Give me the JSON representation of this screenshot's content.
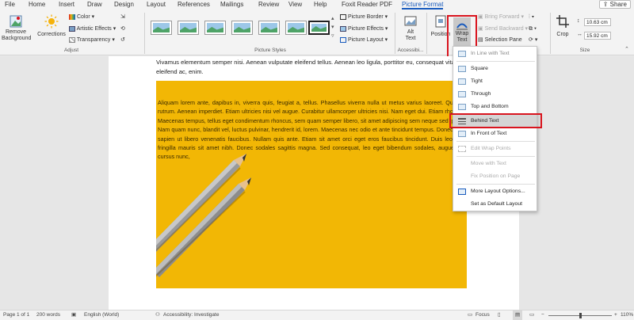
{
  "menu": {
    "tabs": [
      "File",
      "Home",
      "Insert",
      "Draw",
      "Design",
      "Layout",
      "References",
      "Mailings",
      "Review",
      "View",
      "Help",
      "Foxit Reader PDF",
      "Picture Format"
    ],
    "share_label": "Share"
  },
  "ribbon": {
    "adjust": {
      "remove_bg_label": "Remove Background",
      "corrections_label": "Corrections",
      "color_label": "Color",
      "artistic_label": "Artistic Effects",
      "transparency_label": "Transparency",
      "group_label": "Adjust"
    },
    "picture_styles": {
      "border_label": "Picture Border",
      "effects_label": "Picture Effects",
      "layout_label": "Picture Layout",
      "group_label": "Picture Styles"
    },
    "accessibility": {
      "alt_text_label": "Alt Text",
      "group_label": "Accessibi..."
    },
    "arrange": {
      "position_label": "Position",
      "wrap_text_label": "Wrap Text",
      "bring_forward_label": "Bring Forward",
      "send_backward_label": "Send Backward",
      "selection_pane_label": "Selection Pane"
    },
    "size": {
      "crop_label": "Crop",
      "height_value": "10.63 cm",
      "width_value": "15.92 cm",
      "group_label": "Size"
    }
  },
  "document": {
    "intro_text": "Vivamus elementum semper nisi. Aenean vulputate eleifend tellus. Aenean leo ligula, porttitor eu, consequat vitae, eleifend ac, enim.",
    "image_text": "Aliquam lorem ante, dapibus in, viverra quis, feugiat a, tellus. Phasellus viverra nulla ut metus varius laoreet. Quisque rutrum. Aenean imperdiet. Etiam ultricies nisi vel augue. Curabitur ullamcorper ultricies nisi. Nam eget dui. Etiam rhoncus. Maecenas tempus, tellus eget condimentum rhoncus, sem quam semper libero, sit amet adipiscing sem neque sed ipsum. Nam quam nunc, blandit vel, luctus pulvinar, hendrerit id, lorem. Maecenas nec odio et ante tincidunt tempus. Donec vitae sapien ut libero venenatis faucibus. Nullam quis ante. Etiam sit amet orci eget eros faucibus tincidunt. Duis leo. Sed fringilla mauris sit amet nibh. Donec sodales sagittis magna. Sed consequat, leo eget bibendum sodales, augue velit cursus nunc,"
  },
  "wrap_menu": {
    "items": [
      {
        "label": "In Line with Text",
        "enabled": true
      },
      {
        "label": "Square",
        "enabled": true
      },
      {
        "label": "Tight",
        "enabled": true
      },
      {
        "label": "Through",
        "enabled": true
      },
      {
        "label": "Top and Bottom",
        "enabled": true
      },
      {
        "label": "Behind Text",
        "enabled": true,
        "selected": true
      },
      {
        "label": "In Front of Text",
        "enabled": true
      },
      {
        "label": "Edit Wrap Points",
        "enabled": false
      },
      {
        "label": "Move with Text",
        "enabled": false
      },
      {
        "label": "Fix Position on Page",
        "enabled": false
      },
      {
        "label": "More Layout Options...",
        "enabled": true
      },
      {
        "label": "Set as Default Layout",
        "enabled": true
      }
    ]
  },
  "status": {
    "page": "Page 1 of 1",
    "words": "200 words",
    "language": "English (World)",
    "accessibility": "Accessibility: Investigate",
    "focus_label": "Focus",
    "zoom": "110%"
  },
  "colors": {
    "accent": "#185abd",
    "highlight_red": "#d9141e",
    "image_yellow": "#f2b705"
  }
}
